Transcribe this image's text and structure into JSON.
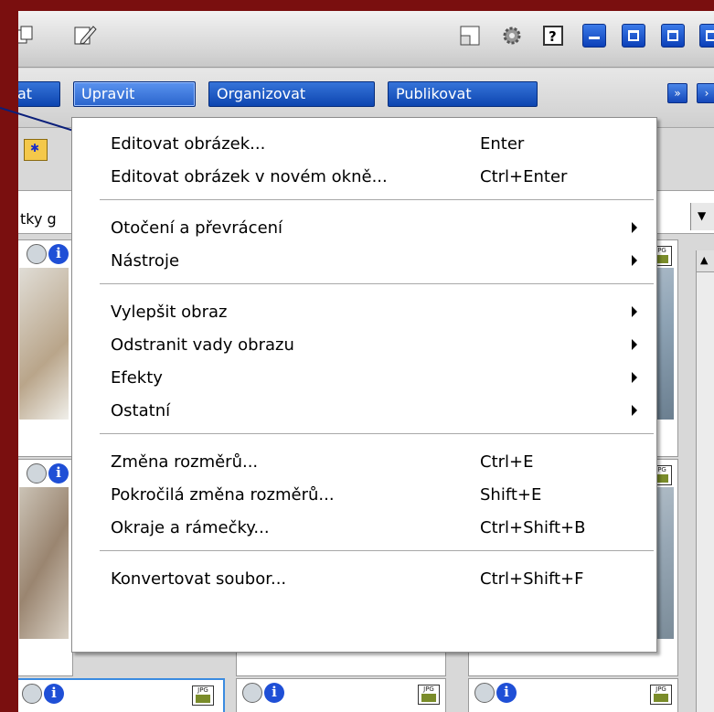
{
  "toolbar": {
    "icons": [
      "copy-icon",
      "edit-icon",
      "window-icon",
      "settings-gear-icon",
      "help-icon",
      "minimize-icon",
      "restore-icon",
      "close-icon"
    ]
  },
  "tabs": [
    {
      "label": "at"
    },
    {
      "label": "Upravit",
      "active": true
    },
    {
      "label": "Organizovat"
    },
    {
      "label": "Publikovat"
    }
  ],
  "filter": {
    "text": "tky g"
  },
  "menu": {
    "groups": [
      [
        {
          "label": "Editovat obrázek...",
          "shortcut": "Enter"
        },
        {
          "label": "Editovat obrázek v novém okně...",
          "shortcut": "Ctrl+Enter"
        }
      ],
      [
        {
          "label": "Otočení a převrácení",
          "submenu": true
        },
        {
          "label": "Nástroje",
          "submenu": true
        }
      ],
      [
        {
          "label": "Vylepšit obraz",
          "submenu": true
        },
        {
          "label": "Odstranit vady obrazu",
          "submenu": true
        },
        {
          "label": "Efekty",
          "submenu": true
        },
        {
          "label": "Ostatní",
          "submenu": true
        }
      ],
      [
        {
          "label": "Změna rozměrů...",
          "shortcut": "Ctrl+E"
        },
        {
          "label": "Pokročilá změna rozměrů...",
          "shortcut": "Shift+E"
        },
        {
          "label": "Okraje a rámečky...",
          "shortcut": "Ctrl+Shift+B"
        }
      ],
      [
        {
          "label": "Konvertovat soubor...",
          "shortcut": "Ctrl+Shift+F"
        }
      ]
    ]
  },
  "thumbnails": {
    "badge_text": "JPG",
    "info_text": "i"
  },
  "colors": {
    "frame": "#7a0f0f",
    "tab_blue": "#0d45b0",
    "menu_bg": "#ffffff",
    "callout_line": "#0b1f7a"
  }
}
